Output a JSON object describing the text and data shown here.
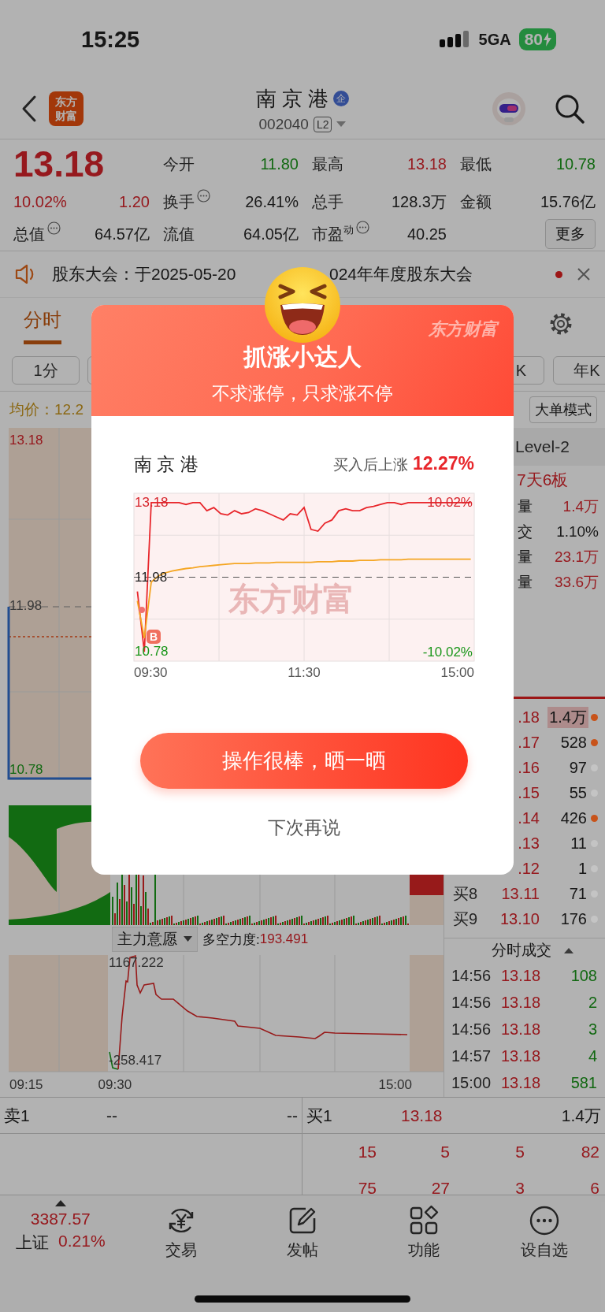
{
  "status_bar": {
    "time": "15:25",
    "network": "5GA",
    "battery": "80",
    "charging": true
  },
  "header": {
    "logo": [
      "东方",
      "财富"
    ],
    "title": "南 京 港",
    "title_badge": "企",
    "code": "002040",
    "level_badge": "L2"
  },
  "quote": {
    "price": "13.18",
    "change_pct": "10.02%",
    "change": "1.20",
    "stats": [
      {
        "label": "今开",
        "value": "11.80",
        "color": "#126912",
        "info": false
      },
      {
        "label": "最高",
        "value": "13.18",
        "color": "#971a1f",
        "info": false
      },
      {
        "label": "最低",
        "value": "10.78",
        "color": "#126912",
        "info": false
      },
      {
        "label": "换手",
        "value": "26.41%",
        "color": "#181818",
        "info": true
      },
      {
        "label": "总手",
        "value": "128.3万",
        "color": "#181818",
        "info": false
      },
      {
        "label": "金额",
        "value": "15.76亿",
        "color": "#181818",
        "info": false
      },
      {
        "label": "总值",
        "value": "64.57亿",
        "color": "#181818",
        "info": true
      },
      {
        "label": "流值",
        "value": "64.05亿",
        "color": "#181818",
        "info": false
      },
      {
        "label": "市盈$^{动}$",
        "value": "40.25",
        "color": "#181818",
        "info": true
      }
    ],
    "more_button": "更多"
  },
  "notice": {
    "text_before": "股东大会：于2025-05-20",
    "text_after": "024年年度股东大会",
    "unread": true
  },
  "tabs": [
    {
      "label": "分时",
      "selected": true
    }
  ],
  "periods_left": [
    {
      "label": "1分",
      "selected": false
    },
    {
      "selected": false
    }
  ],
  "periods_right": [
    {
      "label": "K",
      "selected": false
    },
    {
      "label": "年K",
      "selected": false
    }
  ],
  "avg_price": "均价：12.2",
  "mode_button": "大单模式",
  "price_chart": {
    "top_label": "13.18",
    "mid_label": "11.98",
    "bottom_label": "10.78"
  },
  "indicator": {
    "name": "主力意愿",
    "label": "多空力度:",
    "value": "193.491"
  },
  "flow_chart": {
    "top_label": "1167.222",
    "bottom_label": "-258.417"
  },
  "time_axis": [
    "09:15",
    "09:30",
    "15:00"
  ],
  "level2": {
    "title": "Level-2",
    "streak": "7天6板",
    "stats": [
      {
        "label": "量",
        "value": "1.4万",
        "color": "#971a1f"
      },
      {
        "label": "交",
        "value": "1.10%",
        "color": "#181818"
      },
      {
        "label": "量",
        "value": "23.1万",
        "color": "#971a1f"
      },
      {
        "label": "量",
        "value": "33.6万",
        "color": "#971a1f"
      }
    ]
  },
  "orders": [
    {
      "price": ".18",
      "volume": "1.4万",
      "highlighted": true,
      "color": "#c8531a"
    },
    {
      "price": ".17",
      "volume": "528",
      "highlighted": false,
      "color": "#c8531a"
    },
    {
      "price": ".16",
      "volume": "97",
      "highlighted": false,
      "color": "#c4c4c4"
    },
    {
      "price": ".15",
      "volume": "55",
      "highlighted": false,
      "color": "#c4c4c4"
    },
    {
      "price": ".14",
      "volume": "426",
      "highlighted": false,
      "color": "#c8531a"
    },
    {
      "price": ".13",
      "volume": "11",
      "highlighted": false,
      "color": "#c4c4c4"
    },
    {
      "price": ".12",
      "volume": "1",
      "highlighted": false,
      "color": "#c4c4c4"
    },
    {
      "label": "买8",
      "price": "13.11",
      "volume": "71",
      "highlighted": false,
      "color": "#c4c4c4"
    },
    {
      "label": "买9",
      "price": "13.10",
      "volume": "176",
      "highlighted": false,
      "color": "#c4c4c4"
    }
  ],
  "trades": {
    "title": "分时成交",
    "rows": [
      {
        "time": "14:56",
        "price": "13.18",
        "volume": "108"
      },
      {
        "time": "14:56",
        "price": "13.18",
        "volume": "2"
      },
      {
        "time": "14:56",
        "price": "13.18",
        "volume": "3"
      },
      {
        "time": "14:57",
        "price": "13.18",
        "volume": "4"
      },
      {
        "time": "15:00",
        "price": "13.18",
        "volume": "581"
      }
    ]
  },
  "order_book": {
    "sell": {
      "label": "卖1",
      "price": "--",
      "volume": "--"
    },
    "buy": {
      "label": "买1",
      "price": "13.18",
      "volume": "1.4万"
    },
    "rows": [
      [
        "15",
        "5",
        "5",
        "82"
      ],
      [
        "75",
        "27",
        "3",
        "6"
      ]
    ]
  },
  "bottom_nav": {
    "index": {
      "value": "3387.57",
      "name": "上证",
      "change": "0.21%"
    },
    "items": [
      {
        "label": "交易",
        "kind": "trade"
      },
      {
        "label": "发帖",
        "kind": "post"
      },
      {
        "label": "功能",
        "kind": "apps"
      },
      {
        "label": "设自选",
        "kind": "more"
      }
    ]
  },
  "popup": {
    "title": "抓涨小达人",
    "subtitle": "不求涨停，只求涨不停",
    "brand": "东方财富",
    "stock": "南 京 港",
    "gain_label": "买入后上涨",
    "gain": "12.27%",
    "watermark": "东方财富",
    "upper_limit_label": "10.02%",
    "lower_limit_label": "-10.02%",
    "buy_marker": "B",
    "x_axis_labels": [
      "09:30",
      "11:30",
      "15:00"
    ],
    "chart_data": {
      "type": "line",
      "categories": [
        null,
        null,
        null,
        null,
        null,
        null,
        null,
        null,
        null,
        null,
        null,
        null,
        null,
        null,
        null,
        null,
        null,
        null,
        null,
        null,
        null,
        null,
        null,
        null,
        null,
        null,
        null,
        null,
        null,
        null,
        null,
        null,
        null,
        null,
        null,
        null,
        null,
        null,
        null,
        null,
        null,
        null,
        null,
        null,
        null,
        null,
        null,
        null,
        null
      ],
      "ylim": [
        10.63,
        13.33
      ],
      "grid": true,
      "ref_lines": [
        {
          "axis": "y",
          "value": 11.98
        }
      ],
      "yticks": [
        {
          "value": 13.18,
          "label": "13.18"
        },
        {
          "value": 11.98,
          "label": "11.98"
        },
        {
          "value": 10.78,
          "label": "10.78"
        }
      ],
      "series": [
        {
          "color": "#e8262b",
          "values": [
            11.75,
            10.78,
            13.18,
            13.18,
            13.18,
            13.18,
            13.18,
            13.15,
            13.18,
            13.18,
            13.05,
            13.1,
            13.0,
            12.98,
            13.05,
            13.0,
            13.02,
            13.08,
            13.05,
            13.0,
            12.95,
            12.9,
            13.0,
            12.98,
            13.1,
            12.75,
            12.72,
            12.85,
            12.9,
            13.05,
            13.08,
            13.05,
            13.05,
            13.1,
            13.12,
            13.15,
            13.18,
            13.18,
            13.15,
            13.18,
            13.18,
            13.18,
            13.18,
            13.18,
            13.18,
            13.18,
            13.18,
            13.18,
            13.18
          ]
        },
        {
          "color": "#f5a623",
          "values": [
            11.6,
            11.0,
            11.9,
            12.0,
            12.05,
            12.08,
            12.1,
            12.12,
            12.13,
            12.15,
            12.16,
            12.17,
            12.18,
            12.19,
            12.2,
            12.2,
            12.2,
            12.21,
            12.21,
            12.21,
            12.22,
            12.22,
            12.22,
            12.22,
            12.22,
            12.22,
            12.23,
            12.23,
            12.23,
            12.24,
            12.24,
            12.24,
            12.25,
            12.25,
            12.25,
            12.26,
            12.26,
            12.26,
            12.26,
            12.27,
            12.27,
            12.27,
            12.27,
            12.27,
            12.27,
            12.27,
            12.27,
            12.27,
            12.27
          ]
        }
      ]
    },
    "primary_button": "操作很棒，晒一晒",
    "secondary_button": "下次再说"
  }
}
